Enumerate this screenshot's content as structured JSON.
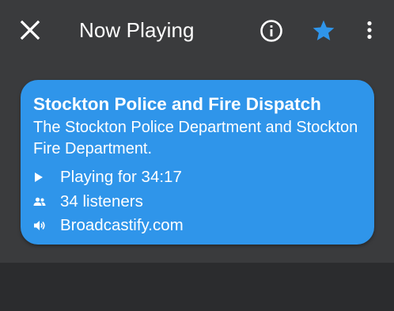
{
  "header": {
    "title": "Now Playing",
    "icons": {
      "close": "close-icon",
      "info": "info-icon",
      "favorite": "star-icon",
      "more": "more-vert-icon"
    }
  },
  "feed": {
    "name": "Stockton Police and Fire Dispatch",
    "description": "The Stockton Police Department and Stockton Fire Department.",
    "playing": "Playing for 34:17",
    "listeners": "34 listeners",
    "source": "Broadcastify.com"
  },
  "colors": {
    "card": "#2f95ea",
    "accent_star": "#2f95ea",
    "background": "#3a3b3d",
    "bottom": "#2b2c2e"
  }
}
